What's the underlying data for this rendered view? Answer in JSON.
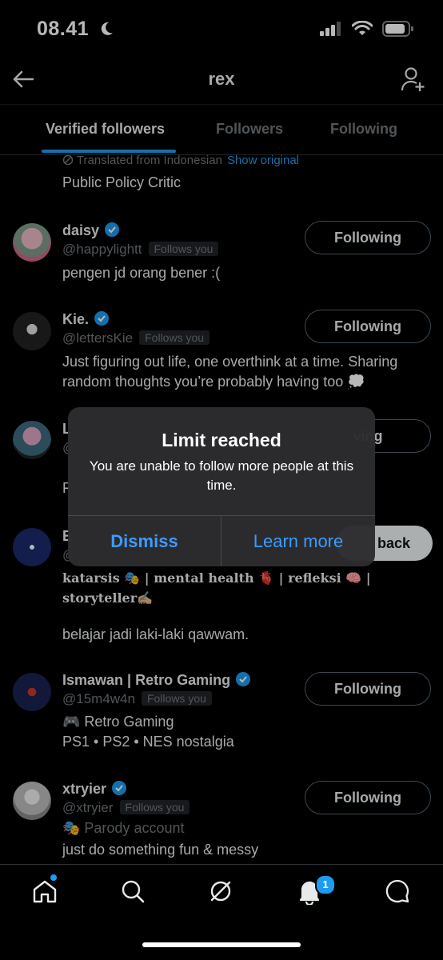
{
  "status": {
    "time": "08.41"
  },
  "header": {
    "title": "rex"
  },
  "tabs": [
    {
      "label": "Verified followers"
    },
    {
      "label": "Followers"
    },
    {
      "label": "Following"
    }
  ],
  "previous": {
    "translated_text": "Translated from Indonesian",
    "show_original": "Show original",
    "bio": "Public Policy Critic"
  },
  "users": [
    {
      "name": "daisy",
      "handle": "@happylightt",
      "follows_you": "Follows you",
      "bio": "pengen jd orang bener :(",
      "button": "Following"
    },
    {
      "name": "Kie.",
      "handle": "@lettersKie",
      "follows_you": "Follows you",
      "bio": "Just figuring out life, one overthink at a time. Sharing random thoughts you’re probably having too 💭",
      "button": "Following"
    },
    {
      "name": "L",
      "handle": "@",
      "bio": "F",
      "button": "ving"
    },
    {
      "name": "E",
      "handle": "@",
      "bio_line1": "katarsis 🎭 | mental health 🫀 | refleksi 🧠 |",
      "bio_line2": "storyteller✍🏼",
      "bio_line3": "belajar jadi laki-laki qawwam.",
      "button": "back"
    },
    {
      "name": "Ismawan | Retro Gaming",
      "handle": "@15m4w4n",
      "follows_you": "Follows you",
      "bio_line1": "🎮 Retro Gaming",
      "bio_line2": "PS1 • PS2 • NES nostalgia",
      "button": "Following"
    },
    {
      "name": "xtryier",
      "handle": "@xtryier",
      "follows_you": "Follows you",
      "bio_line1": "🎭 Parody account",
      "bio_line2": "just do something fun & messy",
      "button": "Following"
    }
  ],
  "dialog": {
    "title": "Limit reached",
    "message": "You are unable to follow more people at this time.",
    "dismiss": "Dismiss",
    "learn_more": "Learn more"
  },
  "bottom_nav": {
    "notification_count": "1"
  },
  "colors": {
    "accent": "#1d9bf0",
    "background": "#000000",
    "dialog_bg": "#2c2c2e",
    "dialog_button": "#3d9bff"
  },
  "icons": [
    "back-arrow-icon",
    "add-user-icon",
    "verified-badge-icon",
    "home-icon",
    "search-icon",
    "grok-icon",
    "bell-icon",
    "messages-icon"
  ]
}
